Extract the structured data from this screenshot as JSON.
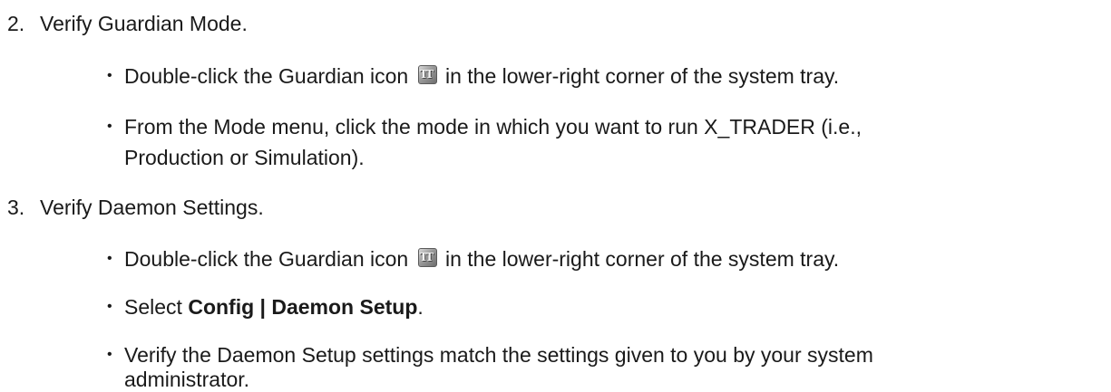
{
  "steps": [
    {
      "number": "2.",
      "title": "Verify Guardian Mode.",
      "bullets": [
        {
          "before": "Double-click the Guardian icon",
          "icon": "guardian-tt-icon",
          "after": "in the lower-right corner of the system tray."
        },
        {
          "line1": "From the Mode menu, click the mode in which you want to run X_TRADER (i.e.,",
          "line2": "Production or Simulation)."
        }
      ]
    },
    {
      "number": "3.",
      "title": "Verify Daemon Settings.",
      "bullets": [
        {
          "before": "Double-click the Guardian icon",
          "icon": "guardian-tt-icon",
          "after": "in the lower-right corner of the system tray."
        },
        {
          "prefix": "Select ",
          "bold": "Config | Daemon Setup",
          "suffix": "."
        },
        {
          "line1": "Verify the Daemon Setup settings match the settings given to you by your system",
          "line2": "administrator."
        }
      ]
    }
  ],
  "icon_glyph": "TT",
  "bullet_glyph": "•"
}
